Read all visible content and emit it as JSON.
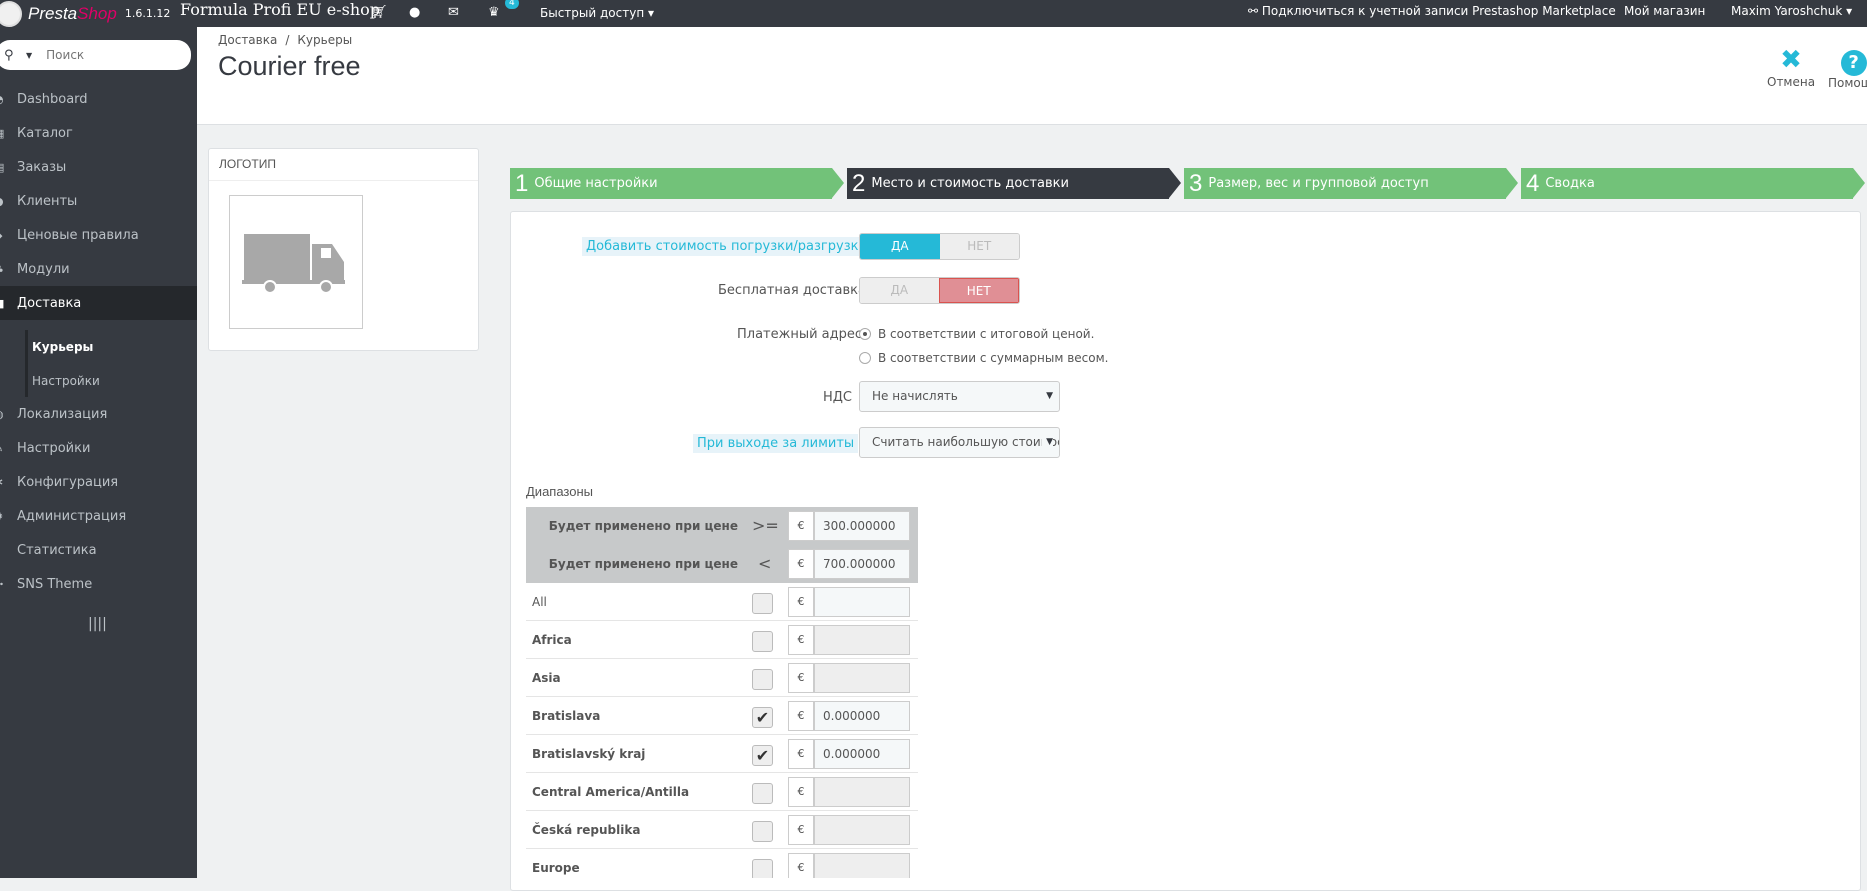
{
  "topbar": {
    "brand_a": "Presta",
    "brand_b": "Shop",
    "version": "1.6.1.12",
    "shop_name": "Formula Profi EU e-shop",
    "notification_count": "4",
    "quick_access": "Быстрый доступ",
    "marketplace": "Подключиться к учетной записи Prestashop Marketplace",
    "my_shop": "Мой магазин",
    "user": "Maxim Yaroshchuk"
  },
  "sidebar": {
    "search_placeholder": "Поиск",
    "items": [
      {
        "label": "Dashboard",
        "icon": "dashboard-icon"
      },
      {
        "label": "Каталог",
        "icon": "catalog-icon"
      },
      {
        "label": "Заказы",
        "icon": "orders-icon"
      },
      {
        "label": "Клиенты",
        "icon": "customers-icon"
      },
      {
        "label": "Ценовые правила",
        "icon": "price-rules-icon"
      },
      {
        "label": "Модули",
        "icon": "modules-icon"
      },
      {
        "label": "Доставка",
        "icon": "shipping-icon"
      },
      {
        "label": "Локализация",
        "icon": "localization-icon"
      },
      {
        "label": "Настройки",
        "icon": "preferences-icon"
      },
      {
        "label": "Конфигурация",
        "icon": "configuration-icon"
      },
      {
        "label": "Администрация",
        "icon": "administration-icon"
      },
      {
        "label": "Статистика",
        "icon": "stats-icon"
      },
      {
        "label": "SNS Theme",
        "icon": "theme-icon"
      }
    ],
    "subitems": [
      "Курьеры",
      "Настройки"
    ]
  },
  "header": {
    "breadcrumb": [
      "Доставка",
      "Курьеры"
    ],
    "title": "Courier free",
    "cancel_label": "Отмена",
    "help_label": "Помощь"
  },
  "logo_panel": {
    "title": "Логотип"
  },
  "steps": [
    {
      "num": "1",
      "label": "Общие настройки"
    },
    {
      "num": "2",
      "label": "Место и стоимость доставки"
    },
    {
      "num": "3",
      "label": "Размер, вес и групповой доступ"
    },
    {
      "num": "4",
      "label": "Сводка"
    }
  ],
  "form": {
    "handling_label": "Добавить стоимость погрузки/разгрузки",
    "free_label": "Бесплатная доставка",
    "yes": "ДА",
    "no": "НЕТ",
    "billing_label": "Платежный адрес",
    "billing_opt1": "В соответствии с итоговой ценой.",
    "billing_opt2": "В соответствии с суммарным весом.",
    "tax_label": "НДС",
    "tax_value": "Не начислять",
    "oor_label": "При выходе за лимиты",
    "oor_value": "Считать наибольшую стоимость"
  },
  "ranges": {
    "title": "Диапазоны",
    "row_label": "Будет применено при цене",
    "op_ge": ">=",
    "op_lt": "<",
    "currency": "€",
    "from": "300.000000",
    "to": "700.000000",
    "zones": [
      {
        "name": "All",
        "checked": false,
        "value": ""
      },
      {
        "name": "Africa",
        "checked": false,
        "value": ""
      },
      {
        "name": "Asia",
        "checked": false,
        "value": ""
      },
      {
        "name": "Bratislava",
        "checked": true,
        "value": "0.000000"
      },
      {
        "name": "Bratislavský kraj",
        "checked": true,
        "value": "0.000000"
      },
      {
        "name": "Central America/Antilla",
        "checked": false,
        "value": ""
      },
      {
        "name": "Česká republika",
        "checked": false,
        "value": ""
      },
      {
        "name": "Europe",
        "checked": false,
        "value": ""
      }
    ]
  }
}
